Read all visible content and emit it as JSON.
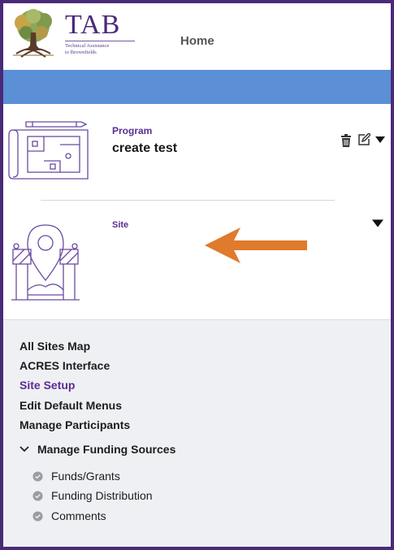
{
  "header": {
    "brand_name": "TAB",
    "brand_subtitle_line1": "Technical Assistance",
    "brand_subtitle_line2": "to Brownfields",
    "home_label": "Home"
  },
  "colors": {
    "frame": "#4a2a78",
    "banner": "#5b8fd6",
    "accent_purple": "#5a2d91",
    "arrow": "#e07a2c",
    "menu_bg": "#eef0f3"
  },
  "cards": {
    "program": {
      "label": "Program",
      "value": "create test",
      "icons": [
        "trash-icon",
        "edit-icon",
        "caret-down-icon"
      ]
    },
    "site": {
      "label": "Site",
      "icons": [
        "caret-down-icon"
      ]
    }
  },
  "menu": {
    "items": [
      {
        "label": "All Sites Map",
        "active": false
      },
      {
        "label": "ACRES Interface",
        "active": false
      },
      {
        "label": "Site Setup",
        "active": true
      },
      {
        "label": "Edit Default Menus",
        "active": false
      },
      {
        "label": "Manage Participants",
        "active": false
      }
    ],
    "group": {
      "label": "Manage Funding Sources",
      "expanded": true,
      "children": [
        {
          "label": "Funds/Grants"
        },
        {
          "label": "Funding Distribution"
        },
        {
          "label": "Comments"
        }
      ]
    }
  }
}
